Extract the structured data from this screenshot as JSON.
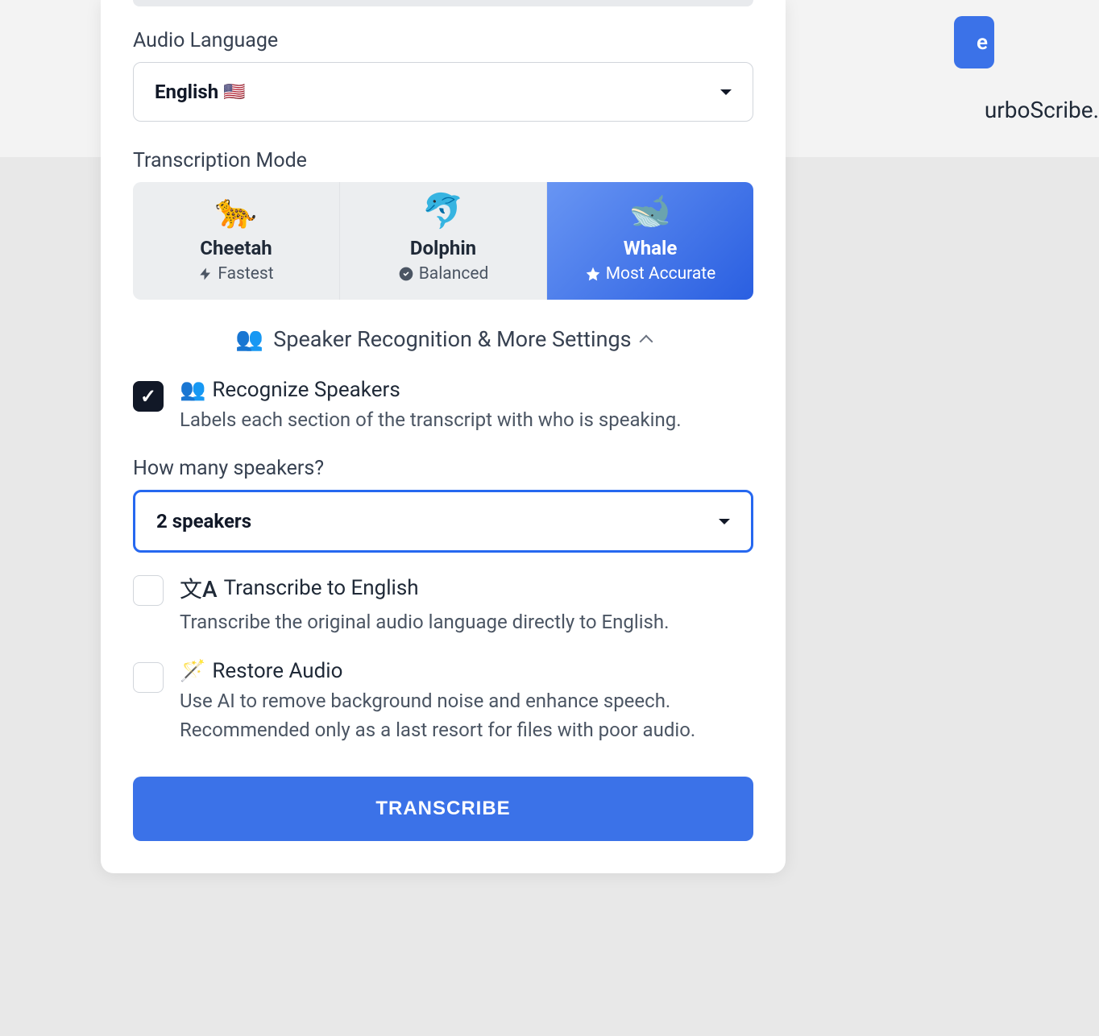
{
  "background": {
    "button_text": "e",
    "text_fragment": "urboScribe."
  },
  "audio_language": {
    "label": "Audio Language",
    "value": "English",
    "flag": "🇺🇸"
  },
  "transcription_mode": {
    "label": "Transcription Mode",
    "options": [
      {
        "emoji": "🐆",
        "name": "Cheetah",
        "subtitle": "Fastest",
        "icon": "bolt",
        "selected": false
      },
      {
        "emoji": "🐬",
        "name": "Dolphin",
        "subtitle": "Balanced",
        "icon": "check-badge",
        "selected": false
      },
      {
        "emoji": "🐋",
        "name": "Whale",
        "subtitle": "Most Accurate",
        "icon": "star",
        "selected": true
      }
    ]
  },
  "settings_toggle": {
    "emoji": "👥",
    "label": "Speaker Recognition & More Settings"
  },
  "recognize_speakers": {
    "checked": true,
    "emoji": "👥",
    "title": "Recognize Speakers",
    "desc": "Labels each section of the transcript with who is speaking."
  },
  "speaker_count": {
    "label": "How many speakers?",
    "value": "2 speakers"
  },
  "transcribe_english": {
    "checked": false,
    "icon": "文A",
    "title": "Transcribe to English",
    "desc": "Transcribe the original audio language directly to English."
  },
  "restore_audio": {
    "checked": false,
    "emoji": "🪄",
    "title": "Restore Audio",
    "desc": "Use AI to remove background noise and enhance speech. Recommended only as a last resort for files with poor audio."
  },
  "transcribe_button": "TRANSCRIBE"
}
